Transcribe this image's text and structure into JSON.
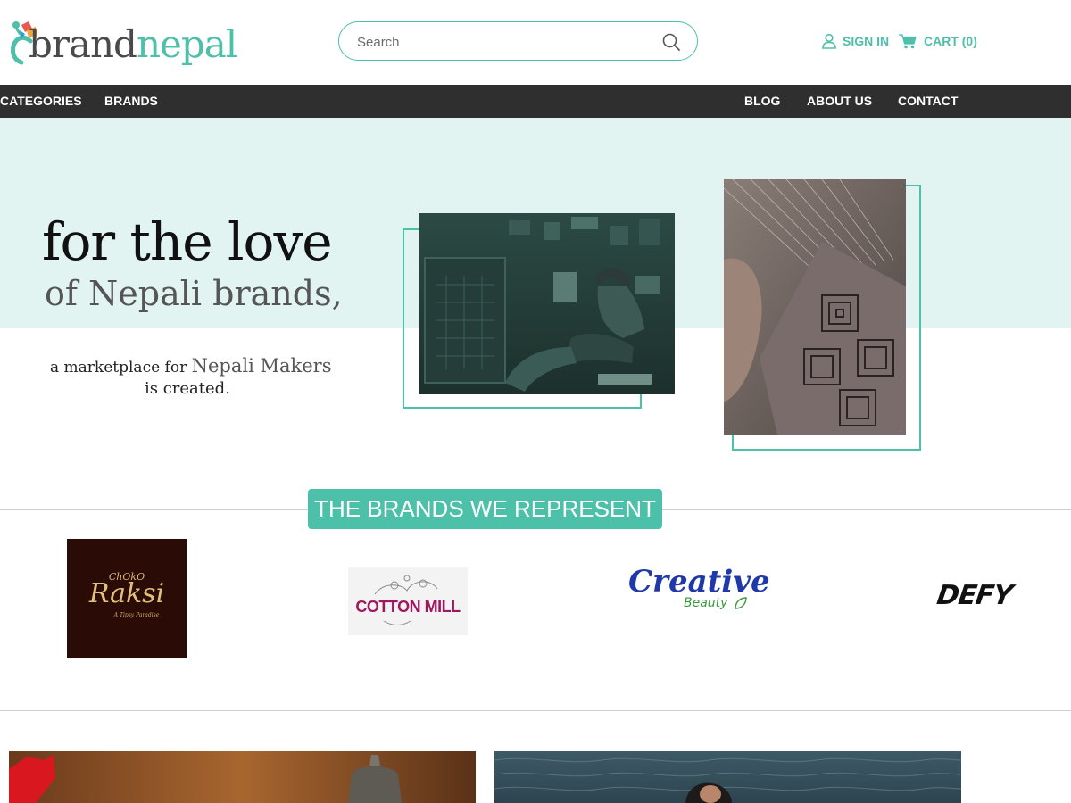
{
  "header": {
    "logo": {
      "part1": "brand",
      "part2": "nepal"
    },
    "search": {
      "placeholder": "Search"
    },
    "account": {
      "sign_in": "SIGN IN",
      "cart": "CART (0)"
    }
  },
  "nav": {
    "left": [
      "CATEGORIES",
      "BRANDS"
    ],
    "right": [
      "BLOG",
      "ABOUT US",
      "CONTACT"
    ]
  },
  "hero": {
    "line1": "for the love",
    "line2": "of Nepali brands,",
    "line3_prefix": "a marketplace for ",
    "line3_highlight": "Nepali Makers",
    "line4": "is created."
  },
  "brands": {
    "title": "THE BRANDS WE REPRESENT",
    "items": [
      {
        "name": "Raksi",
        "top": "ChOkO",
        "sub": "A Tipsy Paradise"
      },
      {
        "name": "COTTON MILL"
      },
      {
        "name": "Creative",
        "sub": "Beauty"
      },
      {
        "name": "DEFY"
      }
    ]
  },
  "colors": {
    "accent": "#4cc0a8",
    "nav_bg": "#2f2f2f",
    "hero_bg": "#e1f4f1"
  }
}
